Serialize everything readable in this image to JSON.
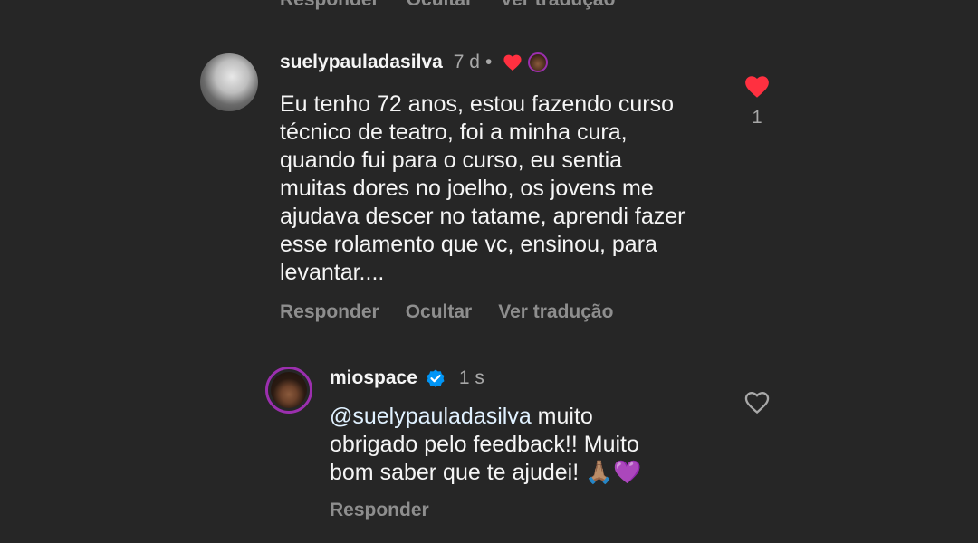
{
  "top_actions": {
    "reply": "Responder",
    "hide": "Ocultar",
    "translate": "Ver tradução"
  },
  "comment": {
    "username": "suelypauladasilva",
    "time": "7 d",
    "separator": "•",
    "text": "Eu tenho 72 anos, estou fazendo curso\ntécnico de teatro, foi a minha cura,\nquando fui para o curso, eu sentia\nmuitas dores no joelho, os jovens me\najudava descer no tatame, aprendi fazer\nesse rolamento que vc, ensinou, para\nlevantar....",
    "like_count": "1",
    "actions": {
      "reply": "Responder",
      "hide": "Ocultar",
      "translate": "Ver tradução"
    },
    "liked": true,
    "liked_by_author": true
  },
  "reply": {
    "username": "miospace",
    "verified": true,
    "time": "1 s",
    "mention": "@suelypauladasilva",
    "text_line1": " muito",
    "text_line2": "obrigado pelo feedback!! Muito",
    "text_line3": "bom saber que te ajudei! 🙏🏽💜",
    "actions": {
      "reply": "Responder"
    },
    "liked": false
  },
  "colors": {
    "background": "#262626",
    "heart": "#ff3040",
    "verified": "#0095f6",
    "muted": "#8e8e8e",
    "story_ring": "#9b2fae"
  }
}
